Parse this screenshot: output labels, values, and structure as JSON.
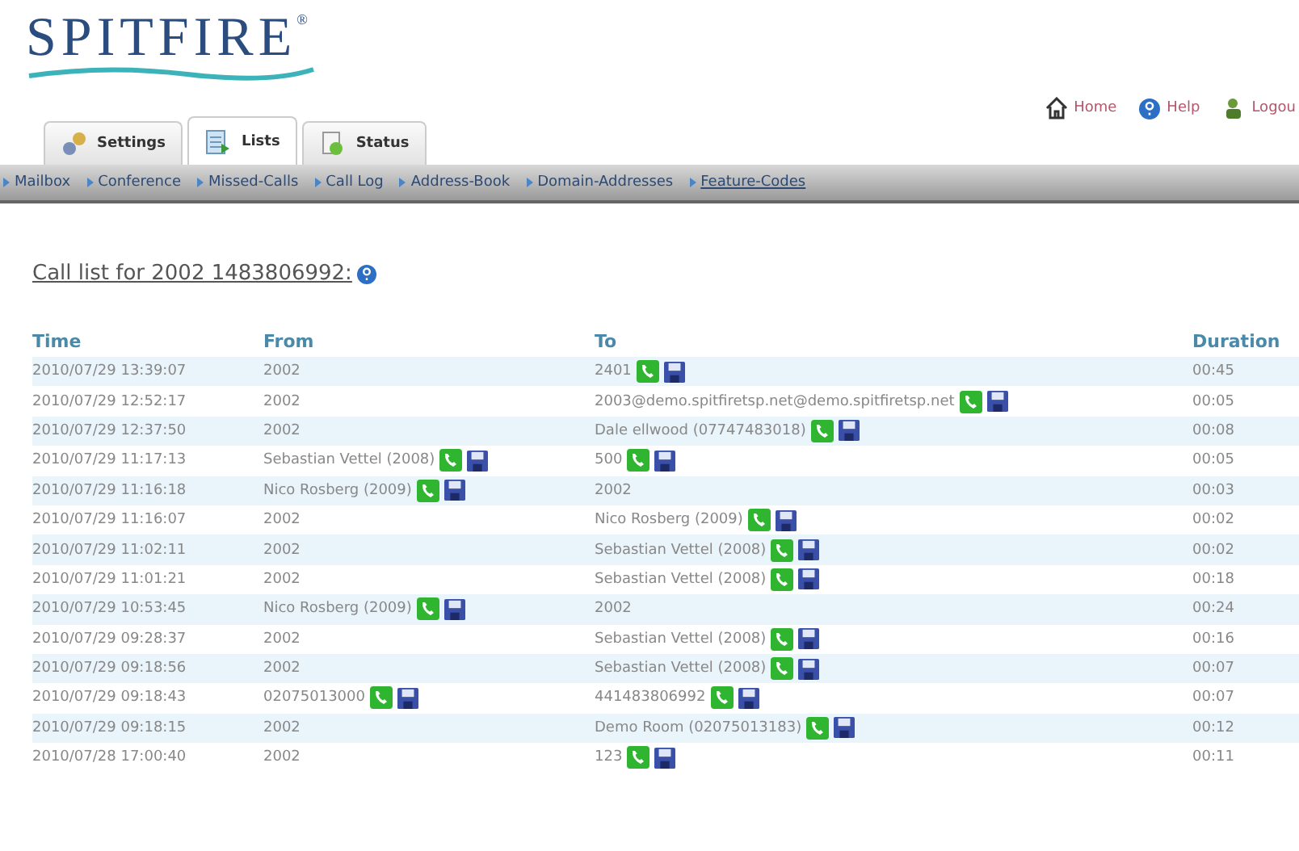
{
  "logo": {
    "text": "SPITFIRE",
    "mark": "®"
  },
  "top_links": [
    {
      "kind": "home",
      "label": "Home"
    },
    {
      "kind": "help",
      "label": "Help"
    },
    {
      "kind": "logout",
      "label": "Logou"
    }
  ],
  "tabs": [
    {
      "kind": "settings",
      "label": "Settings",
      "selected": false
    },
    {
      "kind": "lists",
      "label": "Lists",
      "selected": true
    },
    {
      "kind": "status",
      "label": "Status",
      "selected": false
    }
  ],
  "nav": [
    {
      "label": "Mailbox",
      "hovered": false
    },
    {
      "label": "Conference",
      "hovered": false
    },
    {
      "label": "Missed-Calls",
      "hovered": false
    },
    {
      "label": "Call Log",
      "hovered": false
    },
    {
      "label": "Address-Book",
      "hovered": false
    },
    {
      "label": "Domain-Addresses",
      "hovered": false
    },
    {
      "label": "Feature-Codes",
      "hovered": true
    }
  ],
  "page_title": "Call list for 2002 1483806992:",
  "table": {
    "columns": [
      "Time",
      "From",
      "To",
      "Duration"
    ],
    "rows": [
      {
        "time": "2010/07/29 13:39:07",
        "from": "2002",
        "from_actions": false,
        "to": "2401",
        "to_actions": true,
        "duration": "00:45"
      },
      {
        "time": "2010/07/29 12:52:17",
        "from": "2002",
        "from_actions": false,
        "to": "2003@demo.spitfiretsp.net@demo.spitfiretsp.net",
        "to_actions": true,
        "duration": "00:05"
      },
      {
        "time": "2010/07/29 12:37:50",
        "from": "2002",
        "from_actions": false,
        "to": "Dale ellwood (07747483018)",
        "to_actions": true,
        "duration": "00:08"
      },
      {
        "time": "2010/07/29 11:17:13",
        "from": "Sebastian Vettel (2008)",
        "from_actions": true,
        "to": "500",
        "to_actions": true,
        "duration": "00:05"
      },
      {
        "time": "2010/07/29 11:16:18",
        "from": "Nico Rosberg (2009)",
        "from_actions": true,
        "to": "2002",
        "to_actions": false,
        "duration": "00:03"
      },
      {
        "time": "2010/07/29 11:16:07",
        "from": "2002",
        "from_actions": false,
        "to": "Nico Rosberg (2009)",
        "to_actions": true,
        "duration": "00:02"
      },
      {
        "time": "2010/07/29 11:02:11",
        "from": "2002",
        "from_actions": false,
        "to": "Sebastian Vettel (2008)",
        "to_actions": true,
        "duration": "00:02"
      },
      {
        "time": "2010/07/29 11:01:21",
        "from": "2002",
        "from_actions": false,
        "to": "Sebastian Vettel (2008)",
        "to_actions": true,
        "duration": "00:18"
      },
      {
        "time": "2010/07/29 10:53:45",
        "from": "Nico Rosberg (2009)",
        "from_actions": true,
        "to": "2002",
        "to_actions": false,
        "duration": "00:24"
      },
      {
        "time": "2010/07/29 09:28:37",
        "from": "2002",
        "from_actions": false,
        "to": "Sebastian Vettel (2008)",
        "to_actions": true,
        "duration": "00:16"
      },
      {
        "time": "2010/07/29 09:18:56",
        "from": "2002",
        "from_actions": false,
        "to": "Sebastian Vettel (2008)",
        "to_actions": true,
        "duration": "00:07"
      },
      {
        "time": "2010/07/29 09:18:43",
        "from": "02075013000",
        "from_actions": true,
        "to": "441483806992",
        "to_actions": true,
        "duration": "00:07"
      },
      {
        "time": "2010/07/29 09:18:15",
        "from": "2002",
        "from_actions": false,
        "to": "Demo Room (02075013183)",
        "to_actions": true,
        "duration": "00:12"
      },
      {
        "time": "2010/07/28 17:00:40",
        "from": "2002",
        "from_actions": false,
        "to": "123",
        "to_actions": true,
        "duration": "00:11"
      }
    ]
  }
}
